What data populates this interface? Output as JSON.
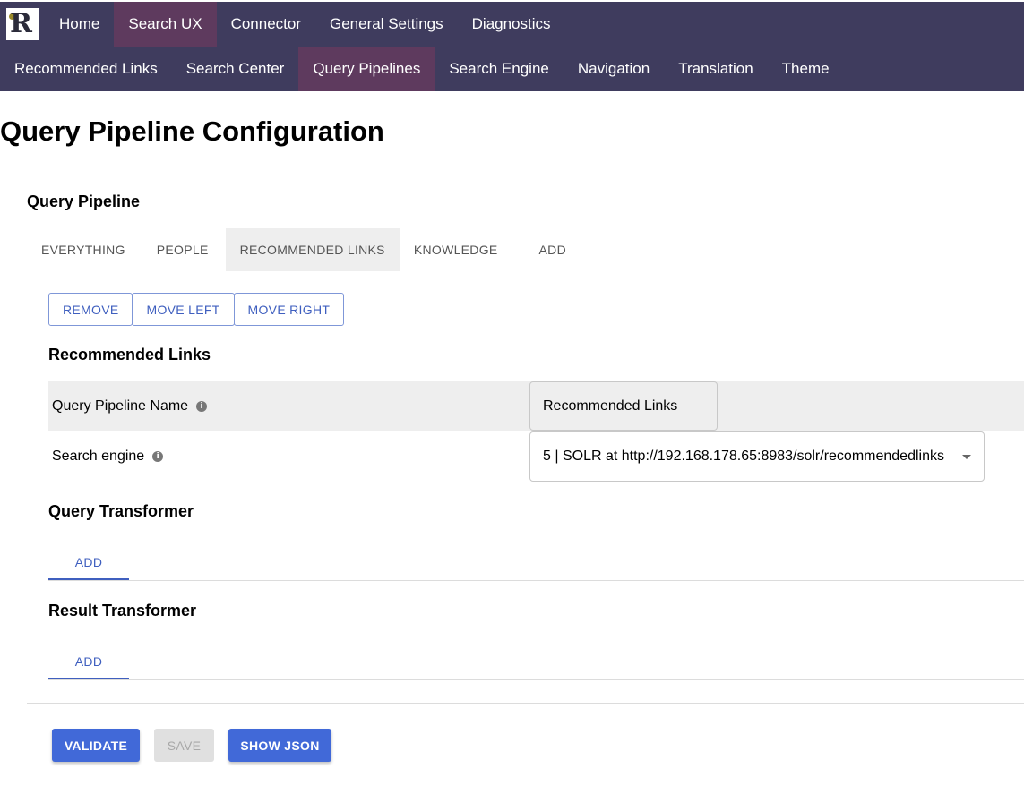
{
  "top_nav": {
    "primary": [
      "Home",
      "Search UX",
      "Connector",
      "General Settings",
      "Diagnostics"
    ],
    "secondary": [
      "Recommended Links",
      "Search Center",
      "Query Pipelines",
      "Search Engine",
      "Navigation",
      "Translation",
      "Theme"
    ],
    "active_primary": "Search UX",
    "active_secondary": "Query Pipelines",
    "colors": {
      "bar": "#3f3c5e",
      "active": "#5e3a5e"
    }
  },
  "page": {
    "title": "Query Pipeline Configuration"
  },
  "query_pipeline": {
    "section_title": "Query Pipeline",
    "tabs": [
      "EVERYTHING",
      "PEOPLE",
      "RECOMMENDED LINKS",
      "KNOWLEDGE",
      "ADD"
    ],
    "active_tab": "RECOMMENDED LINKS",
    "actions": {
      "remove": "REMOVE",
      "move_left": "MOVE LEFT",
      "move_right": "MOVE RIGHT"
    }
  },
  "pipeline": {
    "title": "Recommended Links",
    "name_label": "Query Pipeline Name",
    "name_value": "Recommended Links",
    "engine_label": "Search engine",
    "engine_value": "5 | SOLR at http://192.168.178.65:8983/solr/recommendedlinks",
    "info_icon": "info-icon"
  },
  "query_transformer": {
    "title": "Query Transformer",
    "add_label": "ADD"
  },
  "result_transformer": {
    "title": "Result Transformer",
    "add_label": "ADD"
  },
  "footer": {
    "validate": "VALIDATE",
    "save": "SAVE",
    "show_json": "SHOW JSON",
    "save_disabled": true,
    "accent": "#4169d8"
  }
}
